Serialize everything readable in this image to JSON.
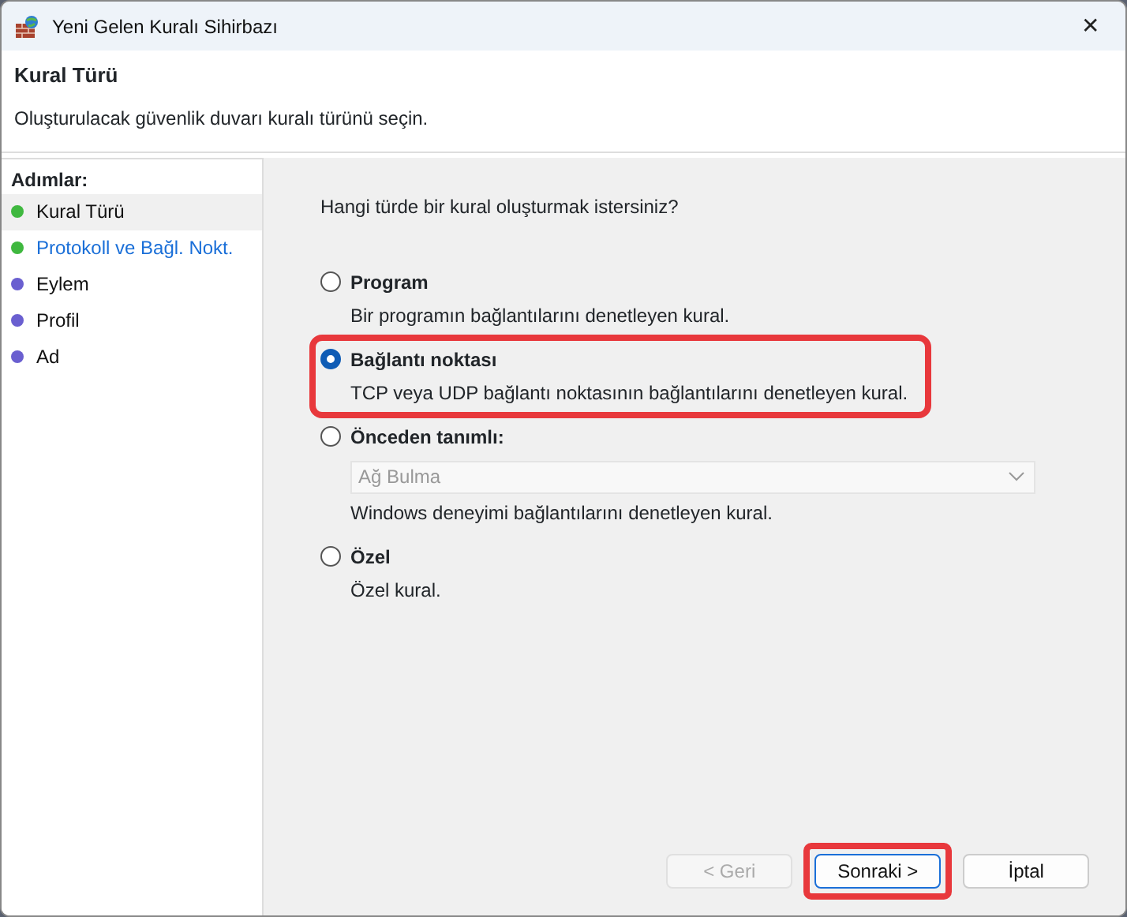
{
  "window": {
    "title": "Yeni Gelen Kuralı Sihirbazı",
    "close": "✕"
  },
  "header": {
    "title": "Kural Türü",
    "subtitle": "Oluşturulacak güvenlik duvarı kuralı türünü seçin."
  },
  "steps_title": "Adımlar:",
  "steps": [
    {
      "label": "Kural Türü",
      "selected": true,
      "kind": "plain",
      "color": "#3fb83f"
    },
    {
      "label": "Protokoll ve Bağl. Nokt.",
      "selected": false,
      "kind": "link",
      "color": "#3fb83f"
    },
    {
      "label": "Eylem",
      "selected": false,
      "kind": "plain",
      "color": "#6a5fd0"
    },
    {
      "label": "Profil",
      "selected": false,
      "kind": "plain",
      "color": "#6a5fd0"
    },
    {
      "label": "Ad",
      "selected": false,
      "kind": "plain",
      "color": "#6a5fd0"
    }
  ],
  "question": "Hangi türde bir kural oluşturmak istersiniz?",
  "options": [
    {
      "label": "Program",
      "description": "Bir programın bağlantılarını denetleyen kural.",
      "selected": false,
      "highlighted": false
    },
    {
      "label": "Bağlantı noktası",
      "description": "TCP veya UDP bağlantı noktasının bağlantılarını denetleyen kural.",
      "selected": true,
      "highlighted": true
    },
    {
      "label": "Önceden tanımlı:",
      "dropdown": {
        "value": "Ağ Bulma",
        "disabled": true
      },
      "description": "Windows deneyimi bağlantılarını denetleyen kural.",
      "selected": false,
      "highlighted": false
    },
    {
      "label": "Özel",
      "description": "Özel kural.",
      "selected": false,
      "highlighted": false
    }
  ],
  "buttons": [
    {
      "label": "< Geri",
      "disabled": true,
      "highlighted": false,
      "default": false
    },
    {
      "label": "Sonraki >",
      "disabled": false,
      "highlighted": true,
      "default": true
    },
    {
      "label": "İptal",
      "disabled": false,
      "highlighted": false,
      "default": false
    }
  ]
}
